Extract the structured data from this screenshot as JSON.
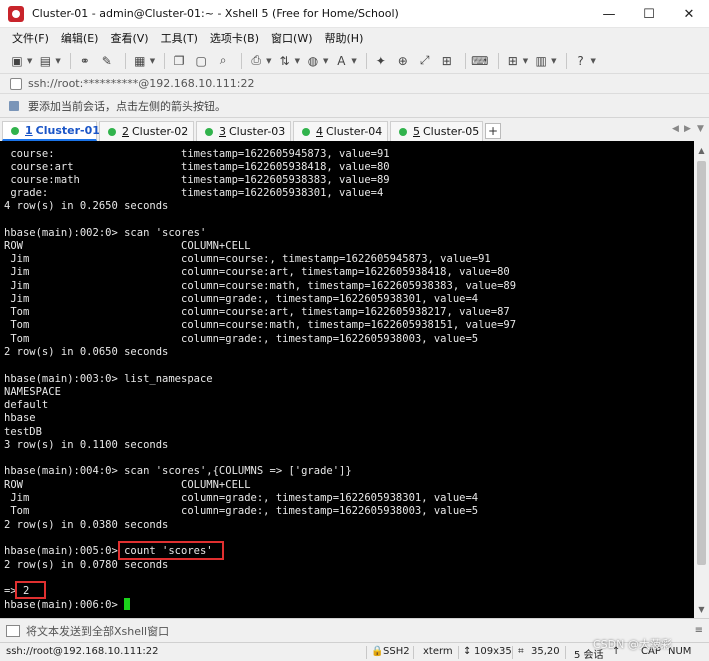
{
  "window": {
    "title": "Cluster-01 - admin@Cluster-01:~ - Xshell 5 (Free for Home/School)",
    "minimize": "—",
    "maximize": "☐",
    "close": "✕"
  },
  "menu": [
    "文件(F)",
    "编辑(E)",
    "查看(V)",
    "工具(T)",
    "选项卡(B)",
    "窗口(W)",
    "帮助(H)"
  ],
  "address": {
    "text": "ssh://root:**********@192.168.10.111:22"
  },
  "hint": {
    "text": "要添加当前会话，点击左侧的箭头按钮。"
  },
  "tabs": [
    {
      "num": "1",
      "label": "Cluster-01",
      "active": true
    },
    {
      "num": "2",
      "label": "Cluster-02",
      "active": false
    },
    {
      "num": "3",
      "label": "Cluster-03",
      "active": false
    },
    {
      "num": "4",
      "label": "Cluster-04",
      "active": false
    },
    {
      "num": "5",
      "label": "Cluster-05",
      "active": false
    }
  ],
  "tab_add": "+",
  "terminal": {
    "lines": [
      " course:                    timestamp=1622605945873, value=91",
      " course:art                 timestamp=1622605938418, value=80",
      " course:math                timestamp=1622605938383, value=89",
      " grade:                     timestamp=1622605938301, value=4",
      "4 row(s) in 0.2650 seconds",
      "",
      "hbase(main):002:0> scan 'scores'",
      "ROW                         COLUMN+CELL",
      " Jim                        column=course:, timestamp=1622605945873, value=91",
      " Jim                        column=course:art, timestamp=1622605938418, value=80",
      " Jim                        column=course:math, timestamp=1622605938383, value=89",
      " Jim                        column=grade:, timestamp=1622605938301, value=4",
      " Tom                        column=course:art, timestamp=1622605938217, value=87",
      " Tom                        column=course:math, timestamp=1622605938151, value=97",
      " Tom                        column=grade:, timestamp=1622605938003, value=5",
      "2 row(s) in 0.0650 seconds",
      "",
      "hbase(main):003:0> list_namespace",
      "NAMESPACE",
      "default",
      "hbase",
      "testDB",
      "3 row(s) in 0.1100 seconds",
      "",
      "hbase(main):004:0> scan 'scores',{COLUMNS => ['grade']}",
      "ROW                         COLUMN+CELL",
      " Jim                        column=grade:, timestamp=1622605938301, value=4",
      " Tom                        column=grade:, timestamp=1622605938003, value=5",
      "2 row(s) in 0.0380 seconds",
      "",
      "hbase(main):005:0> count 'scores'",
      "2 row(s) in 0.0780 seconds",
      "",
      "=> 2",
      "hbase(main):006:0> "
    ]
  },
  "compose": {
    "text": "将文本发送到全部Xshell窗口",
    "menu_icon": "≡"
  },
  "status": {
    "connection": "ssh://root@192.168.10.111:22",
    "protocol": "SSH2",
    "term": "xterm",
    "size": "109x35",
    "pos": "35,20",
    "sessions": "5 会话",
    "caps": "CAP",
    "num": "NUM"
  },
  "watermark": "CSDN @大菠彩"
}
